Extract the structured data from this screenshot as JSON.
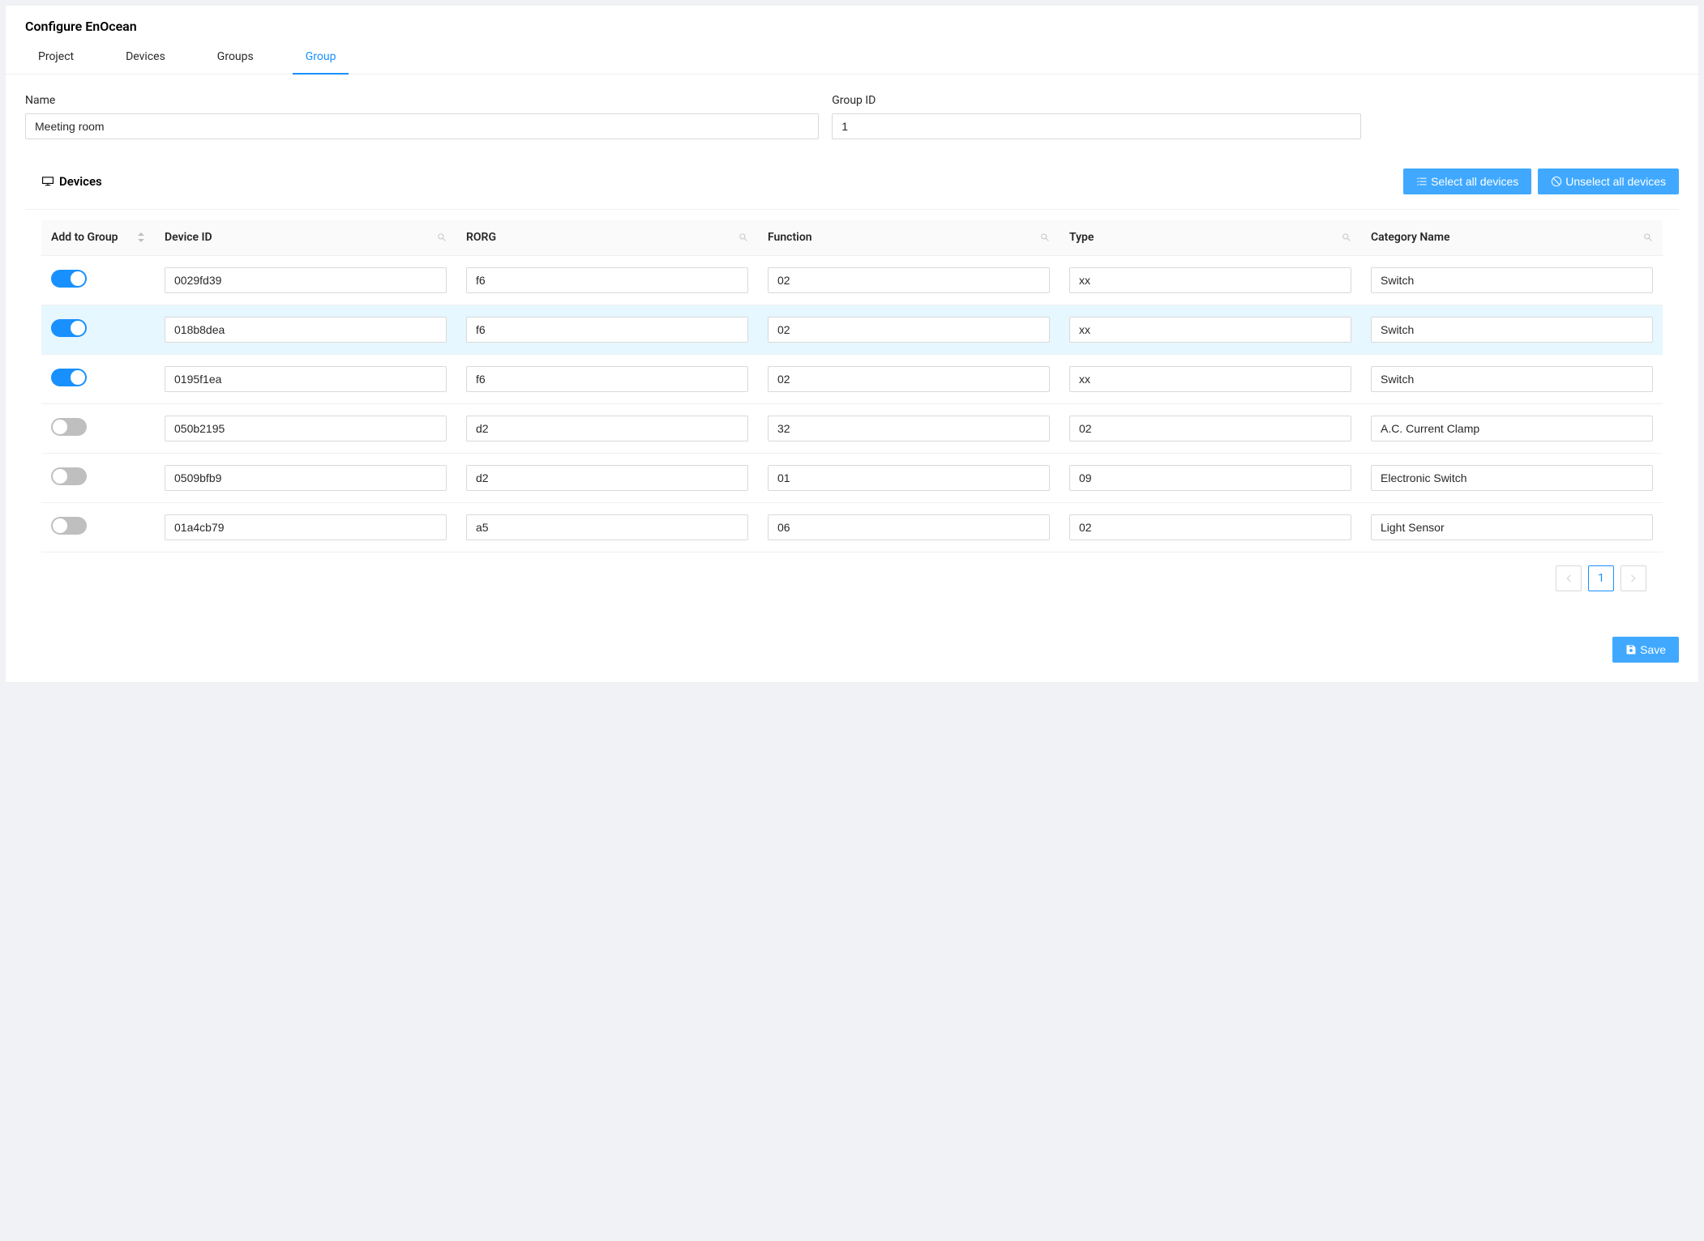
{
  "header": {
    "title": "Configure EnOcean",
    "tabs": [
      {
        "label": "Project",
        "active": false
      },
      {
        "label": "Devices",
        "active": false
      },
      {
        "label": "Groups",
        "active": false
      },
      {
        "label": "Group",
        "active": true
      }
    ]
  },
  "form": {
    "name_label": "Name",
    "name_value": "Meeting room",
    "groupid_label": "Group ID",
    "groupid_value": "1"
  },
  "devices_section": {
    "title": "Devices",
    "select_all_label": "Select all devices",
    "unselect_all_label": "Unselect all devices"
  },
  "table": {
    "columns": {
      "add_to_group": "Add to Group",
      "device_id": "Device ID",
      "rorg": "RORG",
      "function": "Function",
      "type": "Type",
      "category_name": "Category Name"
    },
    "rows": [
      {
        "on": true,
        "highlight": false,
        "device_id": "0029fd39",
        "rorg": "f6",
        "function": "02",
        "type": "xx",
        "category": "Switch"
      },
      {
        "on": true,
        "highlight": true,
        "device_id": "018b8dea",
        "rorg": "f6",
        "function": "02",
        "type": "xx",
        "category": "Switch"
      },
      {
        "on": true,
        "highlight": false,
        "device_id": "0195f1ea",
        "rorg": "f6",
        "function": "02",
        "type": "xx",
        "category": "Switch"
      },
      {
        "on": false,
        "highlight": false,
        "device_id": "050b2195",
        "rorg": "d2",
        "function": "32",
        "type": "02",
        "category": "A.C. Current Clamp"
      },
      {
        "on": false,
        "highlight": false,
        "device_id": "0509bfb9",
        "rorg": "d2",
        "function": "01",
        "type": "09",
        "category": "Electronic Switch"
      },
      {
        "on": false,
        "highlight": false,
        "device_id": "01a4cb79",
        "rorg": "a5",
        "function": "06",
        "type": "02",
        "category": "Light Sensor"
      }
    ]
  },
  "pagination": {
    "current": "1"
  },
  "footer": {
    "save_label": "Save"
  }
}
